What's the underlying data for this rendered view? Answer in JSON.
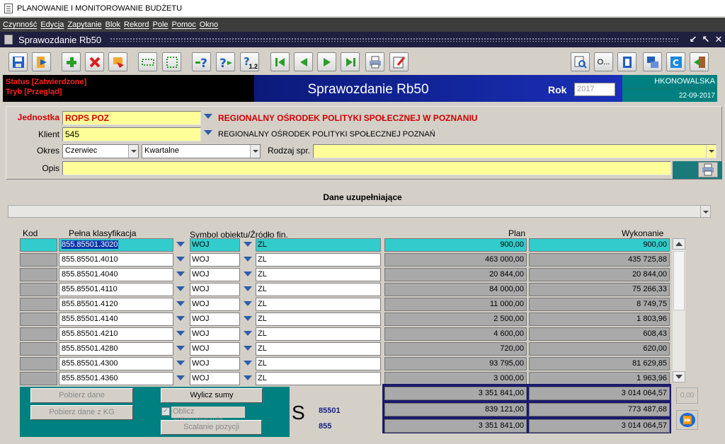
{
  "window": {
    "app_title": "PLANOWANIE I MONITOROWANIE BUDŻETU",
    "form_title": "Sprawozdanie Rb50"
  },
  "menu": [
    "Czynność",
    "Edycja",
    "Zapytanie",
    "Blok",
    "Rekord",
    "Pole",
    "Pomoc",
    "Okno"
  ],
  "toolbar": {
    "help_sub": "1.2",
    "o_button": "O..."
  },
  "header": {
    "status": "Status [Zatwierdzone]",
    "mode": "Tryb [Przegląd]",
    "title": "Sprawozdanie Rb50",
    "rok_label": "Rok",
    "rok_value": "2017",
    "user": "HKONOWALSKA",
    "date": "22-09-2017"
  },
  "form": {
    "jednostka_label": "Jednostka",
    "jednostka_value": "ROPS POZ",
    "jednostka_name": "REGIONALNY OŚRODEK POLITYKI SPOŁECZNEJ W POZNANIU",
    "klient_label": "Klient",
    "klient_value": "545",
    "klient_name": "REGIONALNY OŚRODEK POLITYKI SPOŁECZNEJ POZNAŃ",
    "okres_label": "Okres",
    "okres_month": "Czerwiec",
    "okres_type": "Kwartalne",
    "rodzaj_label": "Rodzaj spr.",
    "rodzaj_value": "",
    "opis_label": "Opis",
    "opis_value": ""
  },
  "section": {
    "title": "Dane uzupełniające"
  },
  "table": {
    "headers": {
      "kod": "Kod",
      "klasyfikacja": "Pełna klasyfikacja",
      "symbol": "Symbol obiektu/Źródło fin.",
      "plan": "Plan",
      "wykonanie": "Wykonanie"
    },
    "rows": [
      {
        "klasyfikacja": "855.85501.3020",
        "symbol": "WOJ",
        "zrodlo": "ZL",
        "plan": "900,00",
        "wykonanie": "900,00"
      },
      {
        "klasyfikacja": "855.85501.4010",
        "symbol": "WOJ",
        "zrodlo": "ZL",
        "plan": "463 000,00",
        "wykonanie": "435 725,88"
      },
      {
        "klasyfikacja": "855.85501.4040",
        "symbol": "WOJ",
        "zrodlo": "ZL",
        "plan": "20 844,00",
        "wykonanie": "20 844,00"
      },
      {
        "klasyfikacja": "855.85501.4110",
        "symbol": "WOJ",
        "zrodlo": "ZL",
        "plan": "84 000,00",
        "wykonanie": "75 266,33"
      },
      {
        "klasyfikacja": "855.85501.4120",
        "symbol": "WOJ",
        "zrodlo": "ZL",
        "plan": "11 000,00",
        "wykonanie": "8 749,75"
      },
      {
        "klasyfikacja": "855.85501.4140",
        "symbol": "WOJ",
        "zrodlo": "ZL",
        "plan": "2 500,00",
        "wykonanie": "1 803,96"
      },
      {
        "klasyfikacja": "855.85501.4210",
        "symbol": "WOJ",
        "zrodlo": "ZL",
        "plan": "4 600,00",
        "wykonanie": "608,43"
      },
      {
        "klasyfikacja": "855.85501.4280",
        "symbol": "WOJ",
        "zrodlo": "ZL",
        "plan": "720,00",
        "wykonanie": "620,00"
      },
      {
        "klasyfikacja": "855.85501.4300",
        "symbol": "WOJ",
        "zrodlo": "ZL",
        "plan": "93 795,00",
        "wykonanie": "81 629,85"
      },
      {
        "klasyfikacja": "855.85501.4360",
        "symbol": "WOJ",
        "zrodlo": "ZL",
        "plan": "3 000,00",
        "wykonanie": "1 963,96"
      }
    ]
  },
  "actions": {
    "pobierz_dane": "Pobierz dane",
    "pobierz_kg": "Pobierz dane z KG",
    "wylicz_sumy": "Wylicz sumy",
    "oblicz_auto": "Oblicz automatycznie",
    "scalanie": "Scalanie pozycji"
  },
  "sums": {
    "marker": "S",
    "label_85501": "85501",
    "label_855": "855",
    "total_plan": "3 351 841,00",
    "total_wyk": "3 014 064,57",
    "s85501_plan": "839 121,00",
    "s85501_wyk": "773 487,68",
    "s855_plan": "3 351 841,00",
    "s855_wyk": "3 014 064,57",
    "zero": "0,00"
  }
}
